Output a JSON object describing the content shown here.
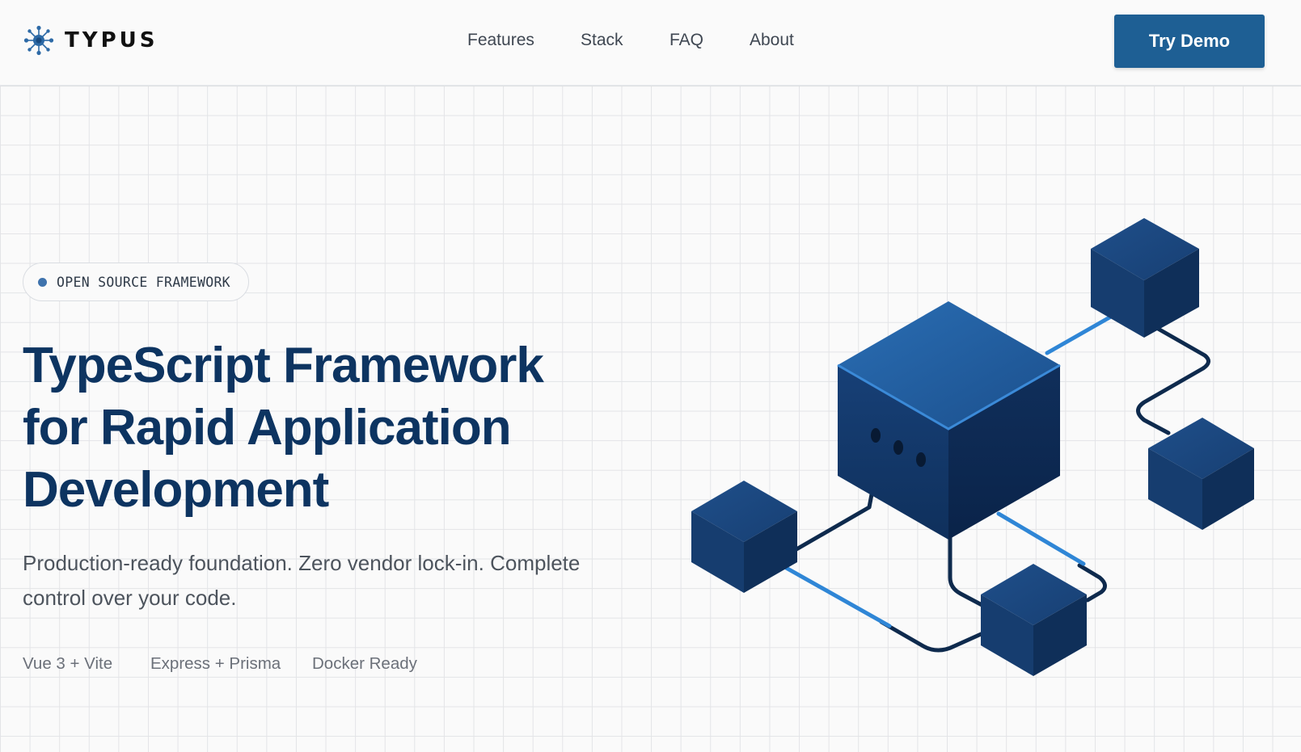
{
  "brand": {
    "name": "TYPUS"
  },
  "nav": {
    "items": [
      {
        "label": "Features"
      },
      {
        "label": "Stack"
      },
      {
        "label": "FAQ"
      },
      {
        "label": "About"
      }
    ],
    "cta_label": "Try Demo"
  },
  "hero": {
    "badge": "OPEN SOURCE FRAMEWORK",
    "headline_lines": [
      "TypeScript Framework",
      "for Rapid Application",
      "Development"
    ],
    "subtitle": "Production-ready foundation. Zero vendor lock-in. Complete control over your code.",
    "tags": [
      "Vue 3 + Vite",
      "Express + Prisma",
      "Docker Ready"
    ]
  },
  "colors": {
    "accent": "#1e5f94",
    "heading": "#0d3461",
    "cube_dark": "#0f3462",
    "connector_light": "#2f86d6"
  },
  "icons": {
    "logo": "network-hub-icon",
    "badge": "dot-icon"
  }
}
